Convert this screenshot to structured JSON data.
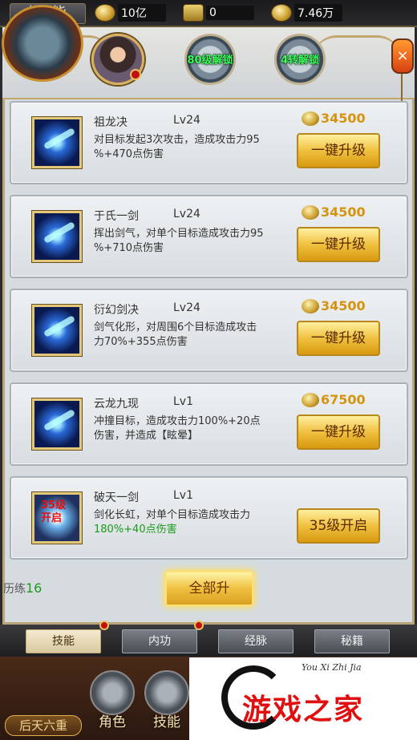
{
  "topbar": {
    "title": "技能",
    "currencies": [
      {
        "icon": "gold-ingot-icon",
        "value": "10亿"
      },
      {
        "icon": "locked-ingot-icon",
        "value": "0"
      },
      {
        "icon": "coin-icon",
        "value": "7.46万"
      }
    ]
  },
  "slots": {
    "slot1_text": "80级解锁",
    "slot2_text": "4转解锁"
  },
  "skills": [
    {
      "name": "祖龙决",
      "level": "Lv24",
      "cost": "34500",
      "desc_a": "对目标发起3次攻击，造成攻击力95",
      "desc_b": "%+470点伤害",
      "button": "一键升级"
    },
    {
      "name": "于氏一剑",
      "level": "Lv24",
      "cost": "34500",
      "desc_a": "挥出剑气，对单个目标造成攻击力95",
      "desc_b": "%+710点伤害",
      "button": "一键升级"
    },
    {
      "name": "衍幻剑决",
      "level": "Lv24",
      "cost": "34500",
      "desc_a": "剑气化形，对周围6个目标造成攻击",
      "desc_b": "力70%+355点伤害",
      "button": "一键升级"
    },
    {
      "name": "云龙九现",
      "level": "Lv1",
      "cost": "67500",
      "desc_a": "冲撞目标，造成攻击力100%+20点",
      "desc_b": "伤害，并造成【眩晕】",
      "button": "一键升级"
    },
    {
      "name": "破天一剑",
      "level": "Lv1",
      "desc_a": "剑化长虹，对单个目标造成攻击力",
      "desc_b": "180%+40点伤害",
      "button": "35级开启",
      "icon_overlay_1": "35级",
      "icon_overlay_2": "开启"
    }
  ],
  "experience": {
    "label": "历练",
    "value": "16"
  },
  "all_button": "全部升",
  "tabs": [
    "技能",
    "内功",
    "经脉",
    "秘籍"
  ],
  "realm": "后天六重",
  "nav": [
    "角色",
    "技能"
  ],
  "watermark": {
    "sub": "You Xi Zhi Jia",
    "big": "游戏之家"
  },
  "colors": {
    "accent_gold": "#f0c040",
    "green_text": "#1a9a1a",
    "unlock_green": "#39ff5a"
  }
}
